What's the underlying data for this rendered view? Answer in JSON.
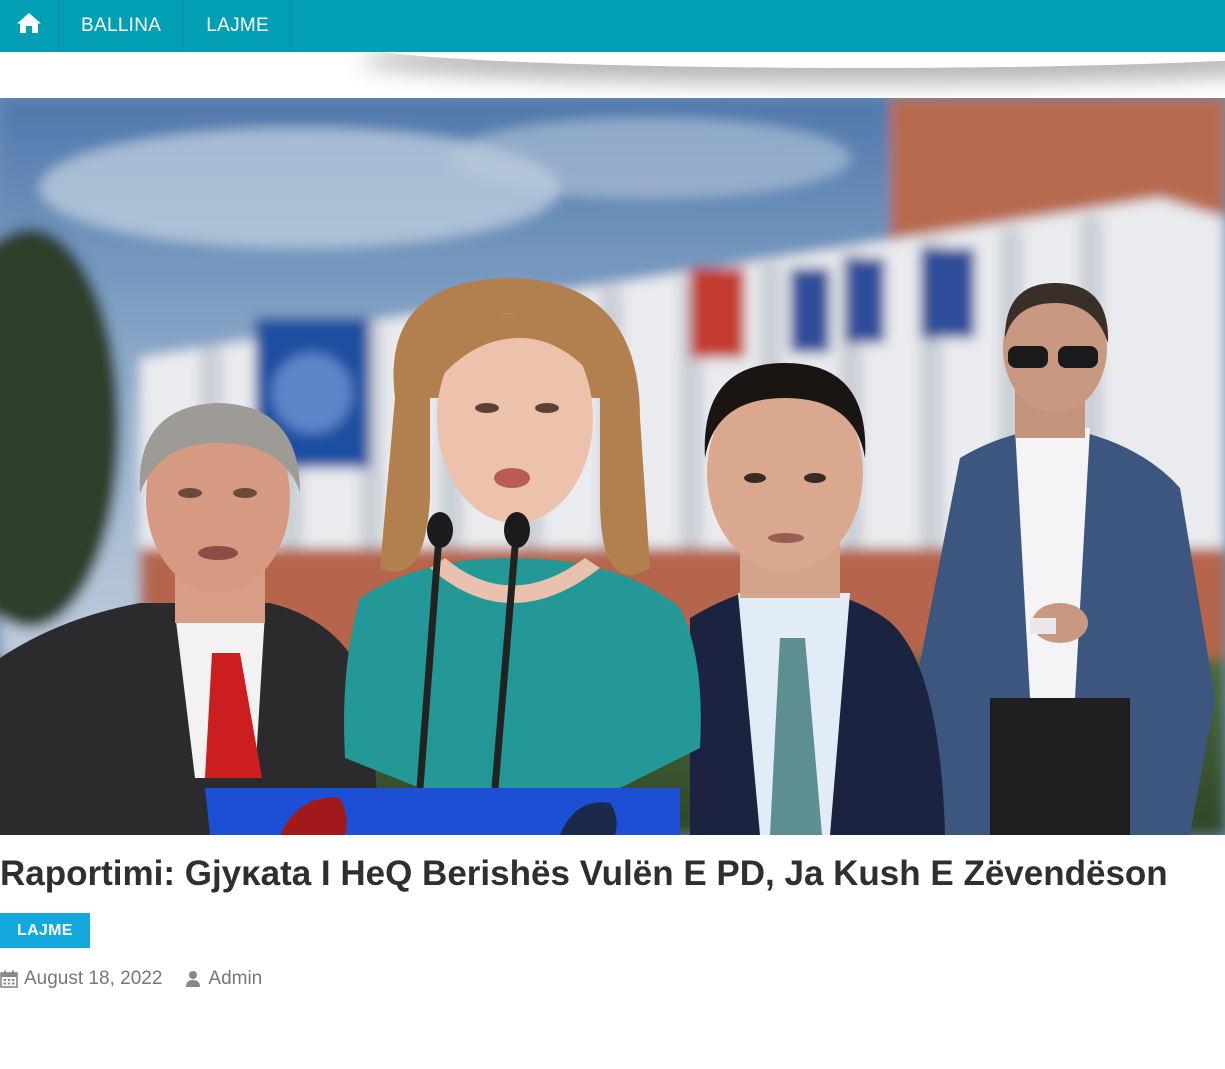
{
  "nav": {
    "home_icon": "home-icon",
    "items": [
      {
        "label": "BALLINA"
      },
      {
        "label": "LAJME"
      }
    ],
    "bg_color": "#029fb4"
  },
  "article": {
    "title": "Raportimi: Gjyĸata I HеQ Berishës Vulën E PD, Ja Kush E Zëvendëson",
    "category": "LAJME",
    "date": "August 18, 2022",
    "author": "Admin",
    "date_icon": "calendar-icon",
    "author_icon": "user-icon",
    "badge_color": "#13a9dd"
  }
}
